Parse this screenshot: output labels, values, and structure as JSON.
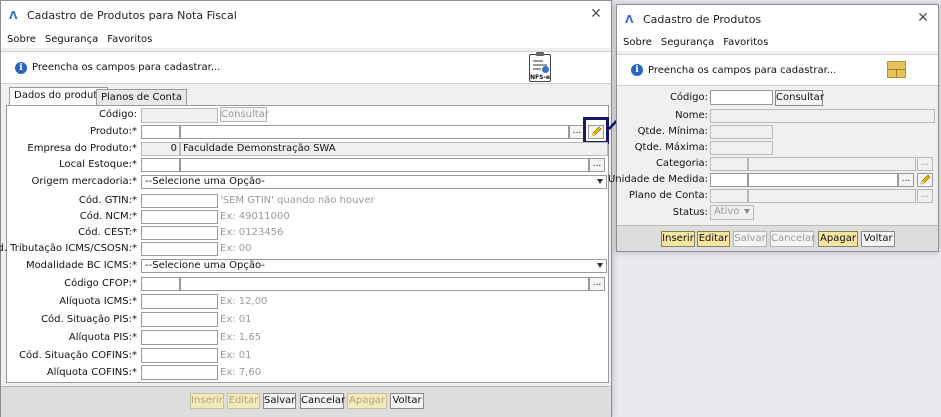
{
  "left_window": {
    "title": "Cadastro de Produtos para Nota Fiscal",
    "menu": [
      "Sobre",
      "Segurança",
      "Favoritos"
    ],
    "info_text": "Preencha os campos para cadastrar...",
    "doc_badge": "NFS-e",
    "tabs": [
      {
        "label": "Dados do produto",
        "active": true
      },
      {
        "label": "Planos de Conta",
        "active": false
      }
    ],
    "fields": {
      "codigo": {
        "label": "Código:",
        "value": ""
      },
      "consultar": "Consultar",
      "produto": {
        "label": "Produto:*",
        "code": "",
        "name": ""
      },
      "empresa": {
        "label": "Empresa do Produto:*",
        "code": "0",
        "name": "Faculdade Demonstração SWA"
      },
      "local_estoque": {
        "label": "Local Estoque:*"
      },
      "origem": {
        "label": "Origem mercadoria:*",
        "selected": "--Selecione uma Opção-"
      },
      "gtin": {
        "label": "Cód. GTIN:*",
        "hint": "'SEM GTIN' quando não houver"
      },
      "ncm": {
        "label": "Cód. NCM:*",
        "hint": "Ex: 49011000"
      },
      "cest": {
        "label": "Cód. CEST:*",
        "hint": "Ex: 0123456"
      },
      "trib": {
        "label": "Cód. Tributação ICMS/CSOSN:*",
        "hint": "Ex: 00"
      },
      "modalidade": {
        "label": "Modalidade BC ICMS:*",
        "selected": "--Selecione uma Opção-"
      },
      "cfop": {
        "label": "Código CFOP:*"
      },
      "aliq_icms": {
        "label": "Alíquota ICMS:*",
        "hint": "Ex: 12,00"
      },
      "sit_pis": {
        "label": "Cód. Situação PIS:*",
        "hint": "Ex: 01"
      },
      "aliq_pis": {
        "label": "Alíquota PIS:*",
        "hint": "Ex: 1,65"
      },
      "sit_cofins": {
        "label": "Cód. Situação COFINS:*",
        "hint": "Ex: 01"
      },
      "aliq_cofins": {
        "label": "Alíquota COFINS:*",
        "hint": "Ex: 7,60"
      }
    },
    "buttons": {
      "inserir": "Inserir",
      "editar": "Editar",
      "salvar": "Salvar",
      "cancelar": "Cancelar",
      "apagar": "Apagar",
      "voltar": "Voltar"
    },
    "lookup_glyph": "..."
  },
  "right_window": {
    "title": "Cadastro de Produtos",
    "menu": [
      "Sobre",
      "Segurança",
      "Favoritos"
    ],
    "info_text": "Preencha os campos para cadastrar...",
    "fields": {
      "codigo": "Código:",
      "consultar": "Consultar",
      "nome": "Nome:",
      "qtde_min": "Qtde. Mínima:",
      "qtde_max": "Qtde. Máxima:",
      "categoria": "Categoria:",
      "unidade": "Unidade de Medida:",
      "plano": "Plano de Conta:",
      "status": {
        "label": "Status:",
        "selected": "Ativo"
      }
    },
    "buttons": {
      "inserir": "Inserir",
      "editar": "Editar",
      "salvar": "Salvar",
      "cancelar": "Cancelar",
      "apagar": "Apagar",
      "voltar": "Voltar"
    }
  },
  "colors": {
    "highlight": "#16166e",
    "gold_button": "#f6e6a2",
    "info_blue": "#2b63c5"
  }
}
